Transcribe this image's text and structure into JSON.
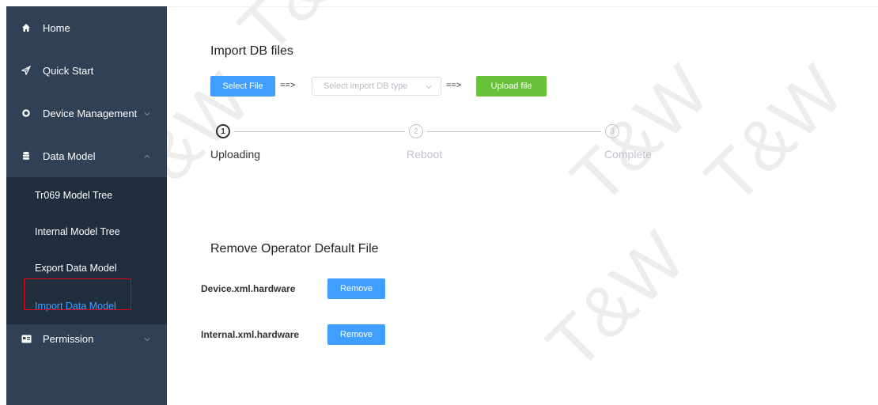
{
  "sidebar": {
    "items": [
      {
        "label": "Home",
        "icon": "home-icon"
      },
      {
        "label": "Quick Start",
        "icon": "send-icon"
      },
      {
        "label": "Device Management",
        "icon": "gear-icon"
      },
      {
        "label": "Data Model",
        "icon": "database-icon"
      },
      {
        "label": "Permission",
        "icon": "id-card-icon"
      }
    ],
    "submenu": [
      {
        "label": "Tr069 Model Tree"
      },
      {
        "label": "Internal Model Tree"
      },
      {
        "label": "Export Data Model"
      },
      {
        "label": "Import Data Model",
        "active": true
      }
    ]
  },
  "import": {
    "title": "Import DB files",
    "select_file_label": "Select File",
    "arrow1": "==>",
    "type_placeholder": "Select import DB type",
    "arrow2": "==>",
    "upload_label": "Upload file"
  },
  "steps": [
    {
      "num": "1",
      "label": "Uploading",
      "status": "done"
    },
    {
      "num": "2",
      "label": "Reboot",
      "status": "wait"
    },
    {
      "num": "3",
      "label": "Complete",
      "status": "wait"
    }
  ],
  "remove": {
    "title": "Remove Operator Default File",
    "files": [
      {
        "name": "Device.xml.hardware",
        "button": "Remove"
      },
      {
        "name": "Internal.xml.hardware",
        "button": "Remove"
      }
    ]
  },
  "watermark": "T&W",
  "colors": {
    "sidebar_bg": "#304156",
    "submenu_bg": "#1f2d3d",
    "active_text": "#409eff",
    "primary": "#409eff",
    "success": "#67c23a",
    "highlight_border": "#d9001b"
  }
}
